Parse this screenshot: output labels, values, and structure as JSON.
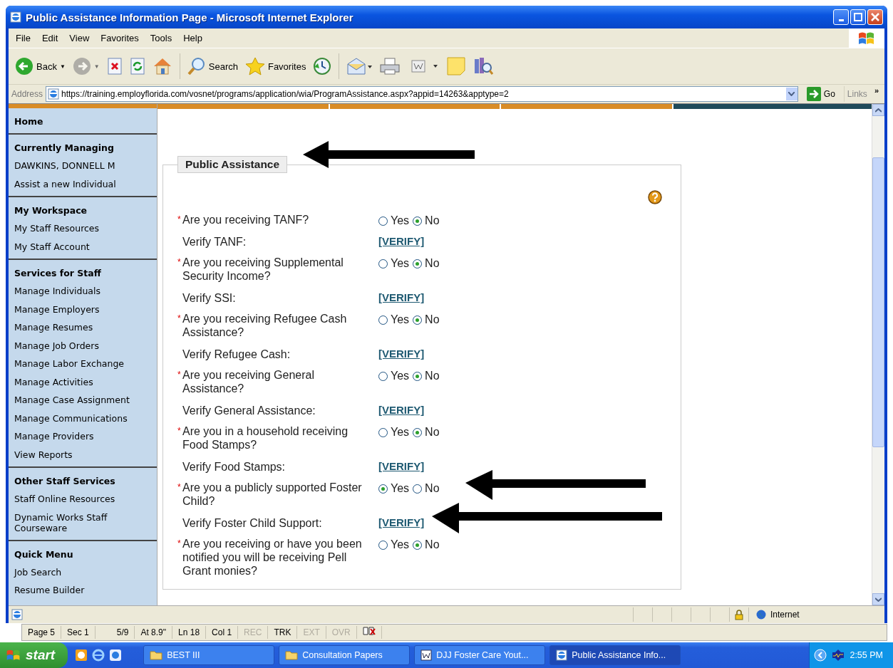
{
  "window": {
    "title": "Public Assistance Information Page - Microsoft Internet Explorer"
  },
  "menu": [
    "File",
    "Edit",
    "View",
    "Favorites",
    "Tools",
    "Help"
  ],
  "toolbar": [
    {
      "kind": "back",
      "label": "Back",
      "caret": "▼",
      "disabled": false
    },
    {
      "kind": "forward",
      "caret": "▼",
      "disabled": true
    },
    {
      "kind": "stop"
    },
    {
      "kind": "refresh"
    },
    {
      "kind": "home"
    },
    {
      "kind": "search",
      "label": "Search"
    },
    {
      "kind": "favorites",
      "label": "Favorites"
    },
    {
      "kind": "history"
    },
    {
      "kind": "mail"
    },
    {
      "kind": "print"
    },
    {
      "kind": "edit"
    },
    {
      "kind": "note"
    },
    {
      "kind": "research"
    }
  ],
  "address": {
    "label": "Address",
    "url": "https://training.employflorida.com/vosnet/programs/application/wia/ProgramAssistance.aspx?appid=14263&apptype=2",
    "go": "Go",
    "links": "Links",
    "chevron": "»"
  },
  "sidebar": [
    {
      "heading": "Home"
    },
    {
      "heading": "Currently Managing",
      "items": [
        "DAWKINS, DONNELL M",
        "Assist a new Individual"
      ]
    },
    {
      "heading": "My Workspace",
      "items": [
        "My Staff Resources",
        "My Staff Account"
      ]
    },
    {
      "heading": "Services for Staff",
      "items": [
        "Manage Individuals",
        "Manage Employers",
        "Manage Resumes",
        "Manage Job Orders",
        "Manage Labor Exchange",
        "Manage Activities",
        "Manage Case Assignment",
        "Manage Communications",
        "Manage Providers",
        "View Reports"
      ]
    },
    {
      "heading": "Other Staff Services",
      "items": [
        "Staff Online Resources",
        "Dynamic Works Staff Courseware"
      ]
    },
    {
      "heading": "Quick Menu",
      "items": [
        "Job Search",
        "Resume Builder"
      ]
    }
  ],
  "form": {
    "legend": "Public Assistance",
    "rows": [
      {
        "kind": "question",
        "marker": "*",
        "text": "Are you receiving TANF?",
        "options": [
          {
            "label": "Yes",
            "selected": false
          },
          {
            "label": "No",
            "selected": true
          }
        ]
      },
      {
        "kind": "verify",
        "text": "Verify TANF:",
        "link": "[VERIFY]"
      },
      {
        "kind": "question",
        "marker": "*",
        "text": "Are you receiving Supplemental Security Income?",
        "options": [
          {
            "label": "Yes",
            "selected": false
          },
          {
            "label": "No",
            "selected": true
          }
        ]
      },
      {
        "kind": "verify",
        "text": "Verify SSI:",
        "link": "[VERIFY]"
      },
      {
        "kind": "question",
        "marker": "*",
        "text": "Are you receiving Refugee Cash Assistance?",
        "options": [
          {
            "label": "Yes",
            "selected": false
          },
          {
            "label": "No",
            "selected": true
          }
        ]
      },
      {
        "kind": "verify",
        "text": "Verify Refugee Cash:",
        "link": "[VERIFY]"
      },
      {
        "kind": "question",
        "marker": "*",
        "text": "Are you receiving General Assistance?",
        "options": [
          {
            "label": "Yes",
            "selected": false
          },
          {
            "label": "No",
            "selected": true
          }
        ]
      },
      {
        "kind": "verify",
        "text": "Verify General Assistance:",
        "link": "[VERIFY]"
      },
      {
        "kind": "question",
        "marker": "*",
        "text": "Are you in a household receiving Food Stamps?",
        "options": [
          {
            "label": "Yes",
            "selected": false
          },
          {
            "label": "No",
            "selected": true
          }
        ]
      },
      {
        "kind": "verify",
        "text": "Verify Food Stamps:",
        "link": "[VERIFY]"
      },
      {
        "kind": "question",
        "marker": "*",
        "text": "Are you a publicly supported Foster Child?",
        "options": [
          {
            "label": "Yes",
            "selected": true
          },
          {
            "label": "No",
            "selected": false
          }
        ]
      },
      {
        "kind": "verify",
        "text": "Verify Foster Child Support:",
        "link": "[VERIFY]"
      },
      {
        "kind": "question",
        "marker": "*",
        "text": "Are you receiving or have you been notified you will be receiving Pell Grant monies?",
        "options": [
          {
            "label": "Yes",
            "selected": false
          },
          {
            "label": "No",
            "selected": true
          }
        ]
      }
    ]
  },
  "status_bar": {
    "zone": "Internet"
  },
  "word_status": [
    {
      "text": "Page 5",
      "disabled": false
    },
    {
      "text": "Sec 1",
      "disabled": false
    },
    {
      "text": "5/9",
      "disabled": false
    },
    {
      "text": "At 8.9\"",
      "disabled": false
    },
    {
      "text": "Ln 18",
      "disabled": false
    },
    {
      "text": "Col 1",
      "disabled": false
    },
    {
      "text": "REC",
      "disabled": true
    },
    {
      "text": "TRK",
      "disabled": false
    },
    {
      "text": "EXT",
      "disabled": true
    },
    {
      "text": "OVR",
      "disabled": true
    }
  ],
  "taskbar": {
    "start": "start",
    "tasks": [
      {
        "kind": "folder",
        "label": "BEST III",
        "selected": false
      },
      {
        "kind": "folder",
        "label": "Consultation Papers",
        "selected": false
      },
      {
        "kind": "word",
        "label": "DJJ Foster Care Yout...",
        "selected": false
      },
      {
        "kind": "ie",
        "label": "Public Assistance Info...",
        "selected": true
      }
    ],
    "clock": "2:55 PM"
  }
}
